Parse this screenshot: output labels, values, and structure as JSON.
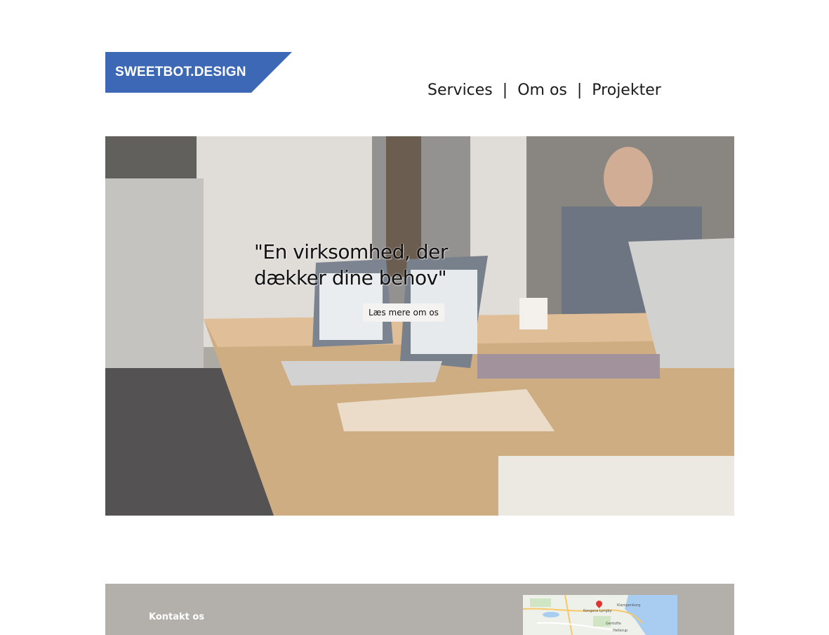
{
  "brand": {
    "name": "SWEETBOT.DESIGN",
    "color": "#3d68b6"
  },
  "nav": {
    "items": [
      {
        "label": "Services"
      },
      {
        "label": "Om os"
      },
      {
        "label": "Projekter"
      }
    ],
    "separator": "|"
  },
  "hero": {
    "quote": "\"En virksomhed, der dækker dine behov\"",
    "button_label": "Læs mere om os"
  },
  "footer": {
    "contact_title": "Kontakt os",
    "background": "#b3afaa",
    "map": {
      "labels": [
        "Klampenborg",
        "Kongens Lyngby",
        "Gentofte",
        "Hellerup"
      ]
    }
  }
}
